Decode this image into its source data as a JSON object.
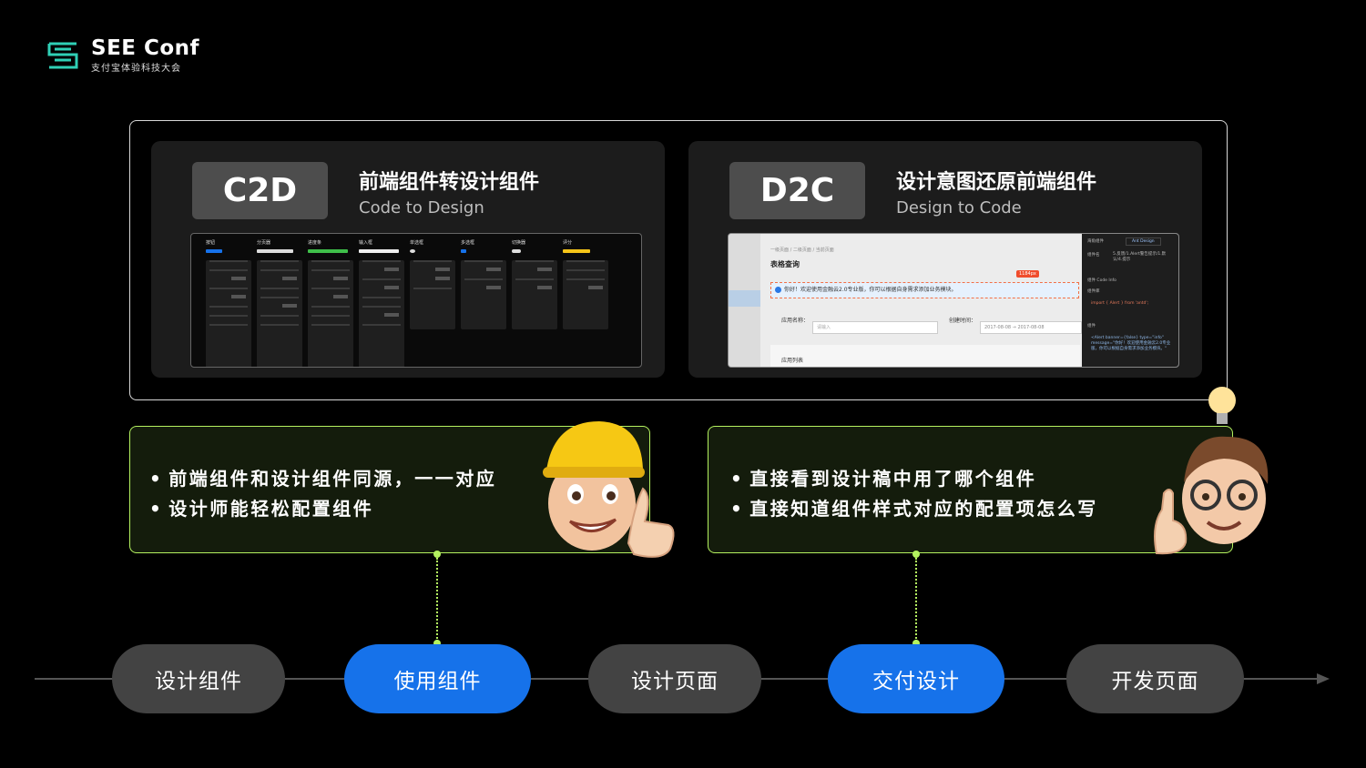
{
  "brand": {
    "title": "SEE Conf",
    "subtitle": "支付宝体验科技大会"
  },
  "cards": [
    {
      "tag": "C2D",
      "title": "前端组件转设计组件",
      "subtitle": "Code to Design"
    },
    {
      "tag": "D2C",
      "title": "设计意图还原前端组件",
      "subtitle": "Design to Code"
    }
  ],
  "c2d_shot": {
    "columns": [
      "按钮",
      "分页器",
      "进度条",
      "输入框",
      "单选框",
      "多选框",
      "切换器",
      "评分"
    ],
    "button_label": "主要"
  },
  "d2c_shot": {
    "breadcrumb": "一级页面 / 二级页面 / 当前页面",
    "page_title": "表格查询",
    "badge": "1184px",
    "alert": "你好！欢迎使用金融云2.0专业版，你可以根据自身需求添加业务模块。",
    "app_name_label": "应用名称：",
    "app_name_placeholder": "请输入",
    "created_label": "创建时间：",
    "date_start": "2017-08-08",
    "date_end": "2017-08-08",
    "list_label": "应用列表",
    "panel_top": "海角组件",
    "panel_lib": "Ant Design",
    "panel_name": "组件名",
    "panel_desc": "5.反馈/1.Alert警告提示/1.默认/4.提示",
    "panel_code_title": "组件 Code Info",
    "panel_import_label": "组件库",
    "panel_import": "import { Alert } from 'antd';",
    "panel_code_label": "组件",
    "panel_code": "<Alert banner={false} type=\"info\" message=\"你好！欢迎使用金融云2.0专业版，你可以根据自身需求添加业务模块。\""
  },
  "callouts": {
    "left": [
      "前端组件和设计组件同源，一一对应",
      "设计师能轻松配置组件"
    ],
    "right": [
      "直接看到设计稿中用了哪个组件",
      "直接知道组件样式对应的配置项怎么写"
    ]
  },
  "timeline": [
    {
      "label": "设计组件",
      "active": false
    },
    {
      "label": "使用组件",
      "active": true
    },
    {
      "label": "设计页面",
      "active": false
    },
    {
      "label": "交付设计",
      "active": true
    },
    {
      "label": "开发页面",
      "active": false
    }
  ],
  "colors": {
    "accent": "#b4f25f",
    "blue": "#1672ea",
    "pill": "#434343",
    "panel": "#1c1c1c"
  }
}
